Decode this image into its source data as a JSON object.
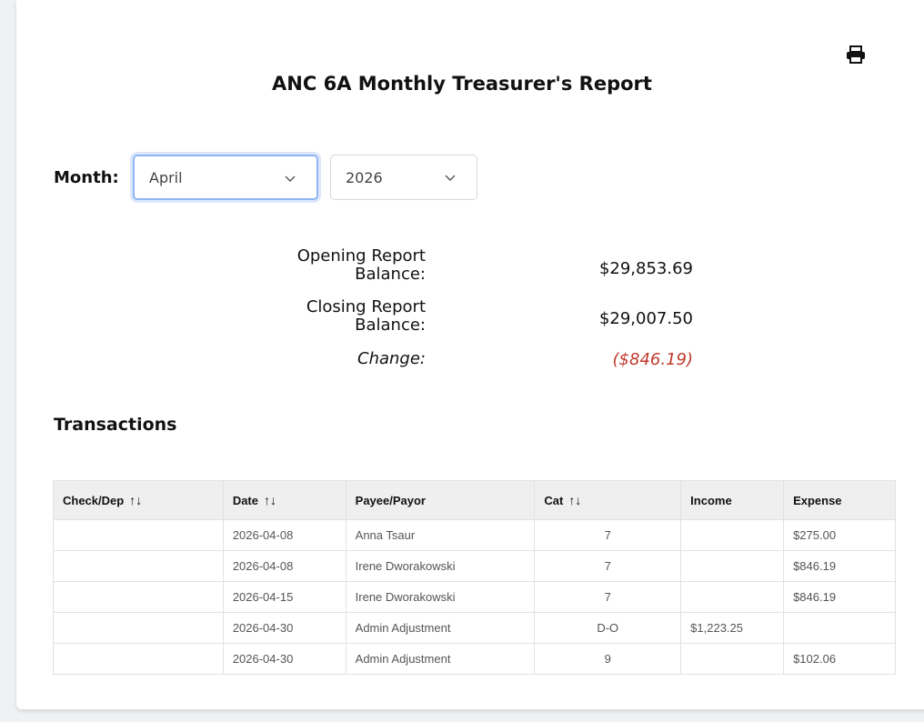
{
  "title": "ANC 6A Monthly Treasurer's Report",
  "icons": {
    "print": "print-icon",
    "chevron": "chevron-down-icon",
    "sort": "sort-arrows-icon"
  },
  "filters": {
    "month_label": "Month:",
    "month_value": "April",
    "year_value": "2026"
  },
  "balances": {
    "opening_label": "Opening Report Balance:",
    "opening_value": "$29,853.69",
    "closing_label": "Closing Report Balance:",
    "closing_value": "$29,007.50",
    "change_label": "Change:",
    "change_value": "($846.19)"
  },
  "transactions": {
    "heading": "Transactions",
    "columns": [
      "Check/Dep",
      "Date",
      "Payee/Payor",
      "Cat",
      "Income",
      "Expense"
    ],
    "sort_glyph": "↑↓",
    "rows": [
      {
        "check": "",
        "date": "2026-04-08",
        "payee": "Anna Tsaur",
        "cat": "7",
        "income": "",
        "expense": "$275.00"
      },
      {
        "check": "",
        "date": "2026-04-08",
        "payee": "Irene Dworakowski",
        "cat": "7",
        "income": "",
        "expense": "$846.19"
      },
      {
        "check": "",
        "date": "2026-04-15",
        "payee": "Irene Dworakowski",
        "cat": "7",
        "income": "",
        "expense": "$846.19"
      },
      {
        "check": "",
        "date": "2026-04-30",
        "payee": "Admin Adjustment",
        "cat": "D-O",
        "income": "$1,223.25",
        "expense": ""
      },
      {
        "check": "",
        "date": "2026-04-30",
        "payee": "Admin Adjustment",
        "cat": "9",
        "income": "",
        "expense": "$102.06"
      }
    ]
  },
  "colors": {
    "negative": "#c0392b",
    "focus": "#8fb5f5",
    "header_bg": "#efefef"
  }
}
